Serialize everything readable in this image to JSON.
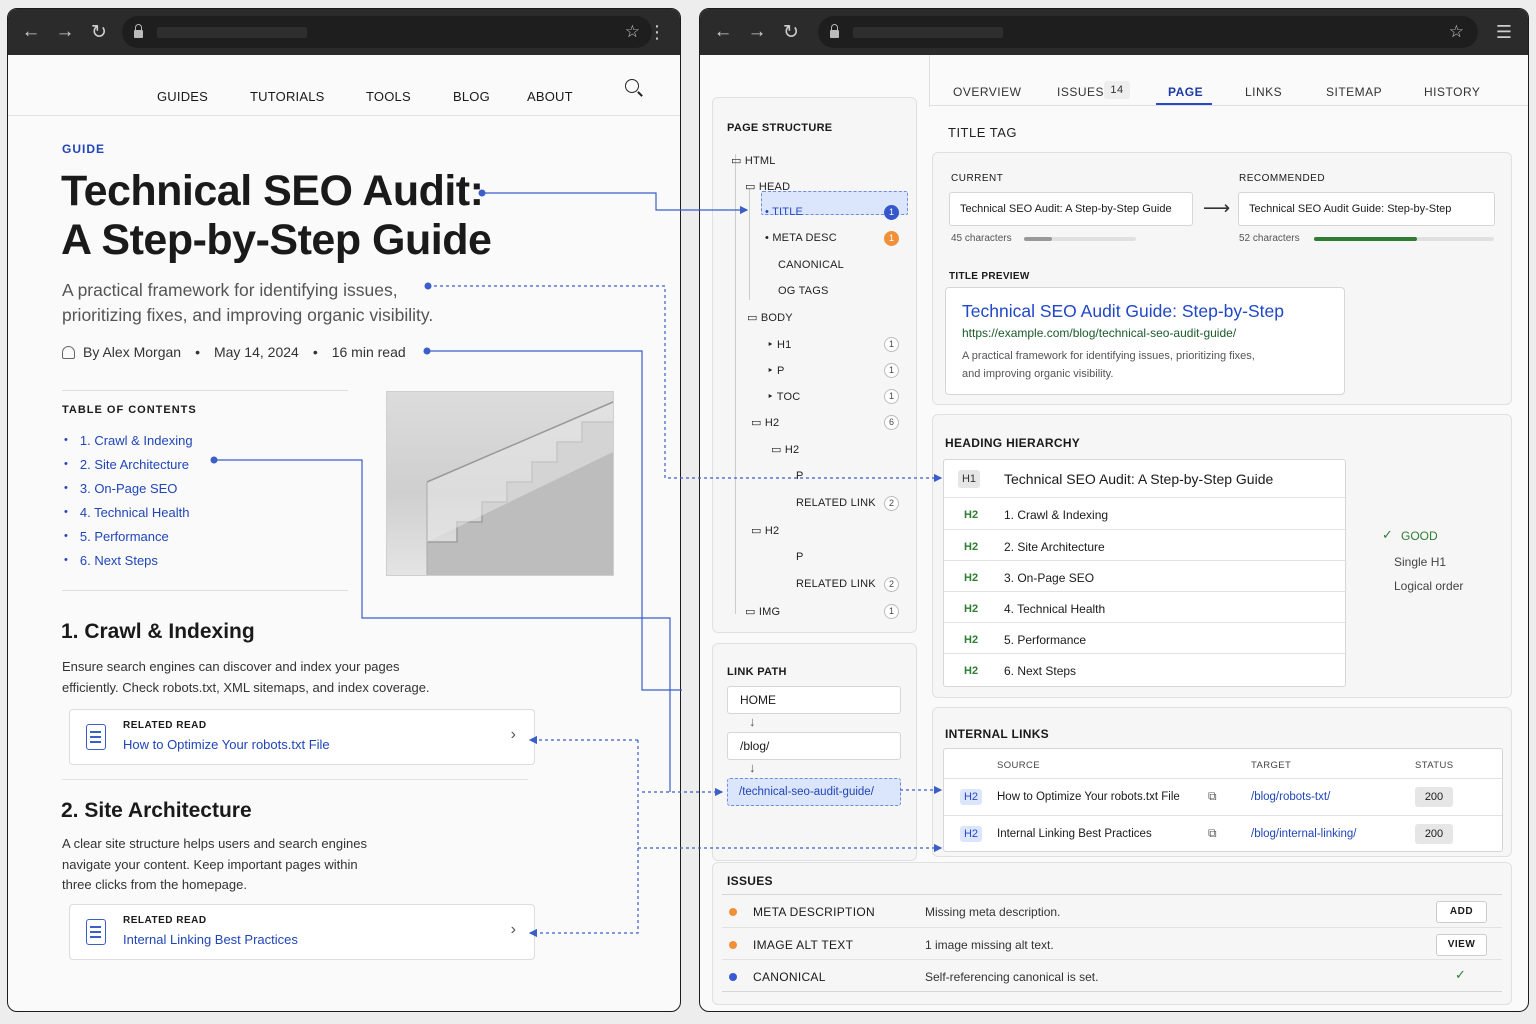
{
  "left": {
    "nav": [
      "GUIDES",
      "TUTORIALS",
      "TOOLS",
      "BLOG",
      "ABOUT"
    ],
    "category": "GUIDE",
    "title_line1": "Technical SEO Audit:",
    "title_line2": "A Step-by-Step Guide",
    "subtitle_line1": "A practical framework for identifying issues,",
    "subtitle_line2": "prioritizing fixes, and improving organic visibility.",
    "author": "By Alex Morgan",
    "date": "May 14, 2024",
    "read_time": "16 min read",
    "toc_heading": "TABLE OF CONTENTS",
    "toc": [
      "1.  Crawl & Indexing",
      "2.  Site Architecture",
      "3.  On-Page SEO",
      "4.  Technical Health",
      "5.  Performance",
      "6.  Next Steps"
    ],
    "section1": {
      "heading": "1. Crawl & Indexing",
      "line1": "Ensure search engines can discover and index your pages",
      "line2": "efficiently. Check robots.txt, XML sitemaps, and index coverage.",
      "related_label": "RELATED READ",
      "related_link": "How to Optimize Your robots.txt File"
    },
    "section2": {
      "heading": "2. Site Architecture",
      "line1": "A clear site structure helps users and search engines",
      "line2": "navigate your content. Keep important pages within",
      "line3": "three clicks from the homepage.",
      "related_label": "RELATED READ",
      "related_link": "Internal Linking Best Practices"
    }
  },
  "right": {
    "tabs": [
      "OVERVIEW",
      "ISSUES",
      "PAGE",
      "LINKS",
      "SITEMAP",
      "HISTORY"
    ],
    "issues_count": "14",
    "active_tab": "PAGE",
    "structure": {
      "heading": "PAGE STRUCTURE",
      "nodes": [
        {
          "label": "HTML",
          "badge": ""
        },
        {
          "label": "HEAD",
          "badge": ""
        },
        {
          "label": "TITLE",
          "badge": "1"
        },
        {
          "label": "META DESC",
          "badge": "1"
        },
        {
          "label": "CANONICAL",
          "badge": ""
        },
        {
          "label": "OG TAGS",
          "badge": ""
        },
        {
          "label": "BODY",
          "badge": ""
        },
        {
          "label": "H1",
          "badge": "1"
        },
        {
          "label": "P",
          "badge": "1"
        },
        {
          "label": "TOC",
          "badge": "1"
        },
        {
          "label": "H2",
          "badge": "6"
        },
        {
          "label": "H2",
          "badge": ""
        },
        {
          "label": "P",
          "badge": ""
        },
        {
          "label": "RELATED LINK",
          "badge": "2"
        },
        {
          "label": "H2",
          "badge": ""
        },
        {
          "label": "P",
          "badge": ""
        },
        {
          "label": "RELATED LINK",
          "badge": "2"
        },
        {
          "label": "IMG",
          "badge": "1"
        }
      ]
    },
    "link_path": {
      "heading": "LINK PATH",
      "steps": [
        "HOME",
        "/blog/",
        "/technical-seo-audit-guide/"
      ]
    },
    "title_tag": {
      "heading": "TITLE TAG",
      "current_label": "CURRENT",
      "current": "Technical SEO Audit: A Step-by-Step Guide",
      "current_chars": "45 characters",
      "current_fill": 0.25,
      "recommended_label": "RECOMMENDED",
      "recommended": "Technical SEO Audit Guide: Step-by-Step",
      "recommended_chars": "52 characters",
      "recommended_fill": 0.57,
      "preview_label": "TITLE PREVIEW",
      "preview_title": "Technical SEO Audit Guide: Step-by-Step",
      "preview_url": "https://example.com/blog/technical-seo-audit-guide/",
      "preview_desc1": "A practical framework for identifying issues, prioritizing fixes,",
      "preview_desc2": "and improving organic visibility."
    },
    "headings": {
      "heading": "HEADING HIERARCHY",
      "rows": [
        {
          "tag": "H1",
          "text": "Technical SEO Audit: A Step-by-Step Guide"
        },
        {
          "tag": "H2",
          "text": "1. Crawl & Indexing"
        },
        {
          "tag": "H2",
          "text": "2. Site Architecture"
        },
        {
          "tag": "H2",
          "text": "3. On-Page SEO"
        },
        {
          "tag": "H2",
          "text": "4. Technical Health"
        },
        {
          "tag": "H2",
          "text": "5. Performance"
        },
        {
          "tag": "H2",
          "text": "6. Next Steps"
        }
      ],
      "status": "GOOD",
      "note1": "Single H1",
      "note2": "Logical order"
    },
    "internal_links": {
      "heading": "INTERNAL LINKS",
      "col_source": "SOURCE",
      "col_target": "TARGET",
      "col_status": "STATUS",
      "rows": [
        {
          "tag": "H2",
          "source": "How to Optimize Your robots.txt File",
          "target": "/blog/robots-txt/",
          "status": "200"
        },
        {
          "tag": "H2",
          "source": "Internal Linking Best Practices",
          "target": "/blog/internal-linking/",
          "status": "200"
        }
      ]
    },
    "issues": {
      "heading": "ISSUES",
      "rows": [
        {
          "name": "META DESCRIPTION",
          "desc": "Missing meta description.",
          "action": "ADD",
          "color": "#f0913a"
        },
        {
          "name": "IMAGE ALT TEXT",
          "desc": "1 image missing alt text.",
          "action": "VIEW",
          "color": "#f0913a"
        },
        {
          "name": "CANONICAL",
          "desc": "Self-referencing canonical is set.",
          "action": "",
          "color": "#3a5bd0"
        }
      ]
    }
  }
}
